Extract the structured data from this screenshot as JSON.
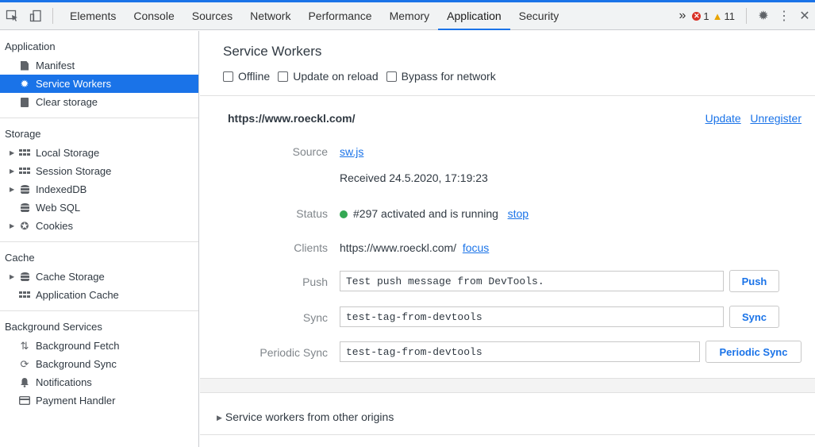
{
  "toolbar": {
    "tabs": [
      "Elements",
      "Console",
      "Sources",
      "Network",
      "Performance",
      "Memory",
      "Application",
      "Security"
    ],
    "active_tab": "Application",
    "more_tabs": "»",
    "error_count": "1",
    "warning_count": "11"
  },
  "sidebar": {
    "application": {
      "header": "Application",
      "items": [
        "Manifest",
        "Service Workers",
        "Clear storage"
      ]
    },
    "storage": {
      "header": "Storage",
      "items": [
        "Local Storage",
        "Session Storage",
        "IndexedDB",
        "Web SQL",
        "Cookies"
      ]
    },
    "cache": {
      "header": "Cache",
      "items": [
        "Cache Storage",
        "Application Cache"
      ]
    },
    "background": {
      "header": "Background Services",
      "items": [
        "Background Fetch",
        "Background Sync",
        "Notifications",
        "Payment Handler"
      ]
    }
  },
  "main": {
    "title": "Service Workers",
    "options": [
      "Offline",
      "Update on reload",
      "Bypass for network"
    ],
    "origin": "https://www.roeckl.com/",
    "update_link": "Update",
    "unregister_link": "Unregister",
    "source_label": "Source",
    "source_link": "sw.js",
    "received": "Received 24.5.2020, 17:19:23",
    "status_label": "Status",
    "status_text": "#297 activated and is running",
    "stop_link": "stop",
    "clients_label": "Clients",
    "clients_url": "https://www.roeckl.com/",
    "focus_link": "focus",
    "push_label": "Push",
    "push_value": "Test push message from DevTools.",
    "push_button": "Push",
    "sync_label": "Sync",
    "sync_value": "test-tag-from-devtools",
    "sync_button": "Sync",
    "periodic_label": "Periodic Sync",
    "periodic_value": "test-tag-from-devtools",
    "periodic_button": "Periodic Sync",
    "other_origins": "Service workers from other origins"
  },
  "colors": {
    "accent": "#1a73e8",
    "status_green": "#34a853",
    "error_red": "#d93025",
    "warning_yellow": "#e8a400"
  }
}
